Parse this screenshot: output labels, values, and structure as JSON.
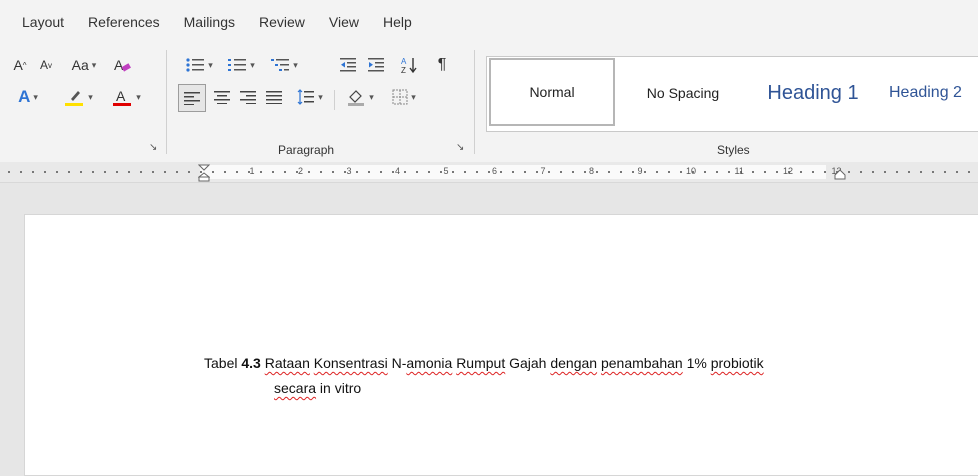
{
  "tabs": [
    "Layout",
    "References",
    "Mailings",
    "Review",
    "View",
    "Help"
  ],
  "ribbon": {
    "font_group": {
      "grow_font": "A",
      "shrink_font": "A",
      "change_case": "Aa",
      "text_effects": "A",
      "font_color": "A"
    },
    "paragraph_label": "Paragraph",
    "styles_label": "Styles",
    "styles": [
      "Normal",
      "No Spacing",
      "Heading 1",
      "Heading 2"
    ]
  },
  "ruler": {
    "numbers": [
      "1",
      "2",
      "3",
      "4",
      "5",
      "6",
      "7",
      "8",
      "9",
      "10",
      "11",
      "12",
      "13"
    ]
  },
  "document": {
    "caption_parts": [
      {
        "text": "Tabel ",
        "style": "plain"
      },
      {
        "text": "4.3",
        "style": "bold"
      },
      {
        "text": " ",
        "style": "plain"
      },
      {
        "text": "Rataan",
        "style": "squiggle"
      },
      {
        "text": " ",
        "style": "plain"
      },
      {
        "text": "Konsentrasi",
        "style": "squiggle"
      },
      {
        "text": " N-",
        "style": "plain"
      },
      {
        "text": "amonia",
        "style": "squiggle"
      },
      {
        "text": " ",
        "style": "plain"
      },
      {
        "text": "Rumput",
        "style": "squiggle"
      },
      {
        "text": " Gajah ",
        "style": "plain"
      },
      {
        "text": "dengan",
        "style": "squiggle"
      },
      {
        "text": " ",
        "style": "plain"
      },
      {
        "text": "penambahan",
        "style": "squiggle"
      },
      {
        "text": " 1% ",
        "style": "plain"
      },
      {
        "text": "probiotik",
        "style": "squiggle"
      }
    ],
    "caption_line2_parts": [
      {
        "text": "secara",
        "style": "squiggle"
      },
      {
        "text": " in vitro",
        "style": "plain"
      }
    ]
  },
  "colors": {
    "heading": "#2f5496",
    "highlight": "#ffe000",
    "font_color_bar": "#e00000",
    "spell_squiggle": "#dd2222"
  }
}
